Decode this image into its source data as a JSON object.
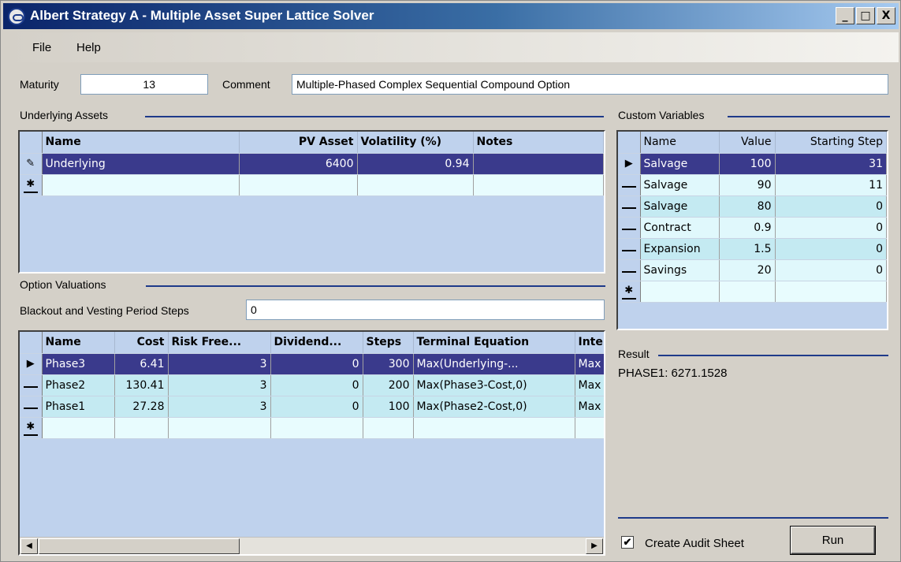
{
  "window": {
    "title": "Albert Strategy A - Multiple Asset Super Lattice Solver",
    "controls": [
      "_",
      "□",
      "X"
    ]
  },
  "menu": {
    "file": "File",
    "help": "Help"
  },
  "maturity": {
    "label": "Maturity",
    "value": "13"
  },
  "comment": {
    "label": "Comment",
    "value": "Multiple-Phased Complex Sequential Compound Option"
  },
  "underlying_assets": {
    "header": "Underlying Assets",
    "columns": [
      "Name",
      "PV Asset",
      "Volatility (%)",
      "Notes"
    ],
    "rows": [
      {
        "marker": "✎",
        "name": "Underlying",
        "pv": "6400",
        "vol": "0.94",
        "notes": ""
      }
    ],
    "new_row_marker": "✱"
  },
  "custom_variables": {
    "header": "Custom Variables",
    "columns": [
      "Name",
      "Value",
      "Starting Step"
    ],
    "rows": [
      {
        "marker": "▶",
        "name": "Salvage",
        "value": "100",
        "step": "31"
      },
      {
        "marker": "",
        "name": "Salvage",
        "value": "90",
        "step": "11"
      },
      {
        "marker": "",
        "name": "Salvage",
        "value": "80",
        "step": "0"
      },
      {
        "marker": "",
        "name": "Contract",
        "value": "0.9",
        "step": "0"
      },
      {
        "marker": "",
        "name": "Expansion",
        "value": "1.5",
        "step": "0"
      },
      {
        "marker": "",
        "name": "Savings",
        "value": "20",
        "step": "0"
      }
    ],
    "new_row_marker": "✱"
  },
  "option_valuations": {
    "header": "Option Valuations",
    "blackout_label": "Blackout and Vesting Period Steps",
    "blackout_value": "0",
    "columns": [
      "Name",
      "Cost",
      "Risk Free...",
      "Dividend...",
      "Steps",
      "Terminal Equation",
      "Inte"
    ],
    "rows": [
      {
        "marker": "▶",
        "name": "Phase3",
        "cost": "6.41",
        "rf": "3",
        "div": "0",
        "steps": "300",
        "eq": "Max(Underlying-...",
        "inter": "Max"
      },
      {
        "marker": "",
        "name": "Phase2",
        "cost": "130.41",
        "rf": "3",
        "div": "0",
        "steps": "200",
        "eq": "Max(Phase3-Cost,0)",
        "inter": "Max"
      },
      {
        "marker": "",
        "name": "Phase1",
        "cost": "27.28",
        "rf": "3",
        "div": "0",
        "steps": "100",
        "eq": "Max(Phase2-Cost,0)",
        "inter": "Max"
      }
    ],
    "new_row_marker": "✱"
  },
  "result": {
    "header": "Result",
    "text": "PHASE1: 6271.1528"
  },
  "audit": {
    "label": "Create Audit Sheet",
    "checked": "✔"
  },
  "run_button": "Run",
  "scroll_icons": {
    "left": "◀",
    "right": "▶"
  }
}
